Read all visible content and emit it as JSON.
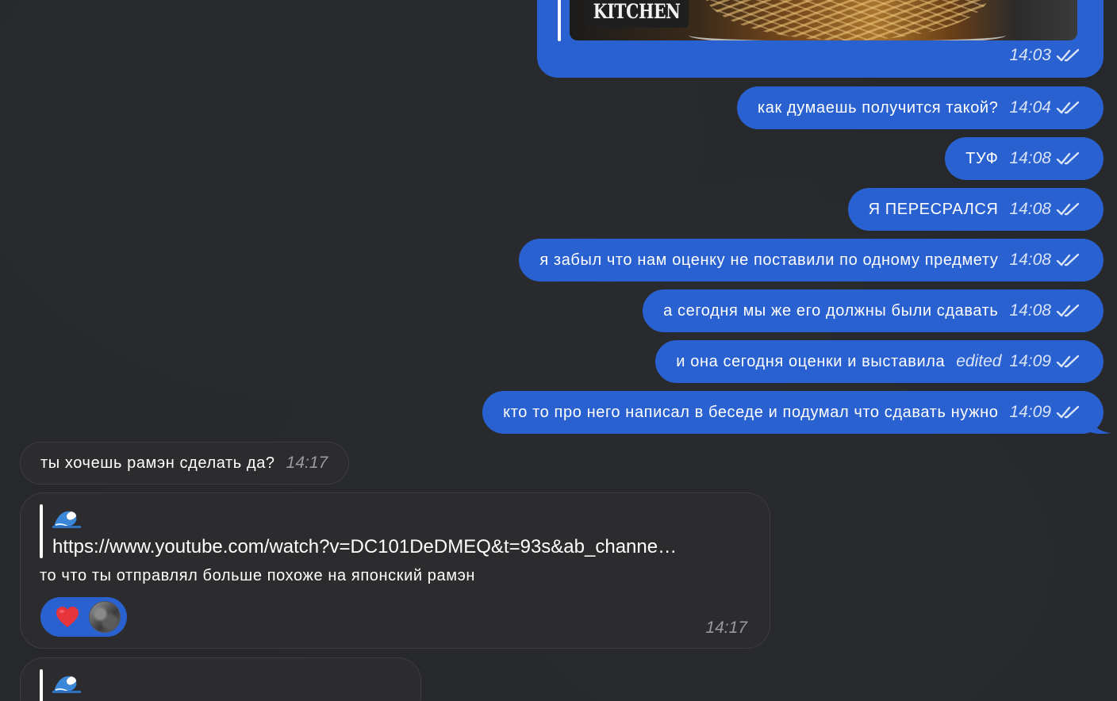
{
  "chat": {
    "first_message": {
      "brand_text": "KITCHEN",
      "time": "14:03"
    },
    "outgoing": [
      {
        "text": "как думаешь получится такой?",
        "time": "14:04",
        "edited": ""
      },
      {
        "text": "ТУФ",
        "time": "14:08",
        "edited": ""
      },
      {
        "text": "Я ПЕРЕСРАЛСЯ",
        "time": "14:08",
        "edited": ""
      },
      {
        "text": "я забыл что нам оценку не поставили по одному предмету",
        "time": "14:08",
        "edited": ""
      },
      {
        "text": "а сегодня мы же его должны были сдавать",
        "time": "14:08",
        "edited": ""
      },
      {
        "text": "и она сегодня оценки и выставила",
        "time": "14:09",
        "edited": "edited"
      },
      {
        "text": "кто то про него написал в беседе и подумал что сдавать нужно",
        "time": "14:09",
        "edited": ""
      }
    ],
    "incoming": [
      {
        "text": "ты хочешь рамэн сделать да?",
        "time": "14:17"
      },
      {
        "quote_emoji": "wave-emoji",
        "quote_link": "https://www.youtube.com/watch?v=DC101DeDMEQ&t=93s&ab_channe…",
        "text": "то что ты отправлял больше похоже на японский рамэн",
        "reaction": "heart",
        "time": "14:17"
      },
      {
        "quote_emoji": "wave-emoji"
      }
    ],
    "colors": {
      "background": "#26282b",
      "outgoing_bubble": "#2a61d0",
      "incoming_bubble": "#2c2c2e",
      "incoming_time": "#9a9aa0",
      "heart": "#e8343b"
    }
  }
}
